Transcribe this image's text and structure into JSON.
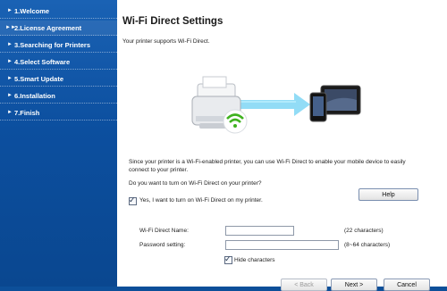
{
  "sidebar": {
    "items": [
      {
        "label": "1.Welcome",
        "active": false
      },
      {
        "label": "2.License Agreement",
        "active": true
      },
      {
        "label": "3.Searching for Printers",
        "active": false
      },
      {
        "label": "4.Select Software",
        "active": false
      },
      {
        "label": "5.Smart Update",
        "active": false
      },
      {
        "label": "6.Installation",
        "active": false
      },
      {
        "label": "7.Finish",
        "active": false
      }
    ]
  },
  "main": {
    "title": "Wi-Fi Direct Settings",
    "subtitle": "Your printer supports Wi-Fi Direct.",
    "description": "Since your printer is a Wi-Fi-enabled printer, you can use Wi-Fi Direct to enable your mobile device to easily connect to your printer.",
    "question": "Do you want to turn on Wi-Fi Direct on your printer?",
    "help_label": "Help",
    "enable_checkbox": {
      "label": "Yes, I want to turn on Wi-Fi Direct on my printer.",
      "checked": true
    },
    "name_field": {
      "label": "Wi-Fi Direct Name:",
      "value": "",
      "hint": "(22 characters)"
    },
    "password_field": {
      "label": "Password setting:",
      "value": "",
      "hint": "(8~64 characters)"
    },
    "hide_checkbox": {
      "label": "Hide characters",
      "checked": true
    }
  },
  "footer": {
    "back_label": "< Back",
    "next_label": "Next >",
    "cancel_label": "Cancel"
  },
  "colors": {
    "sidebar": "#0c4f9f",
    "wifi_green": "#3fb21f",
    "arrow_blue": "#4fc3f0"
  },
  "icons": [
    "printer-icon",
    "wifi-icon",
    "tablet-icon",
    "phone-icon"
  ]
}
